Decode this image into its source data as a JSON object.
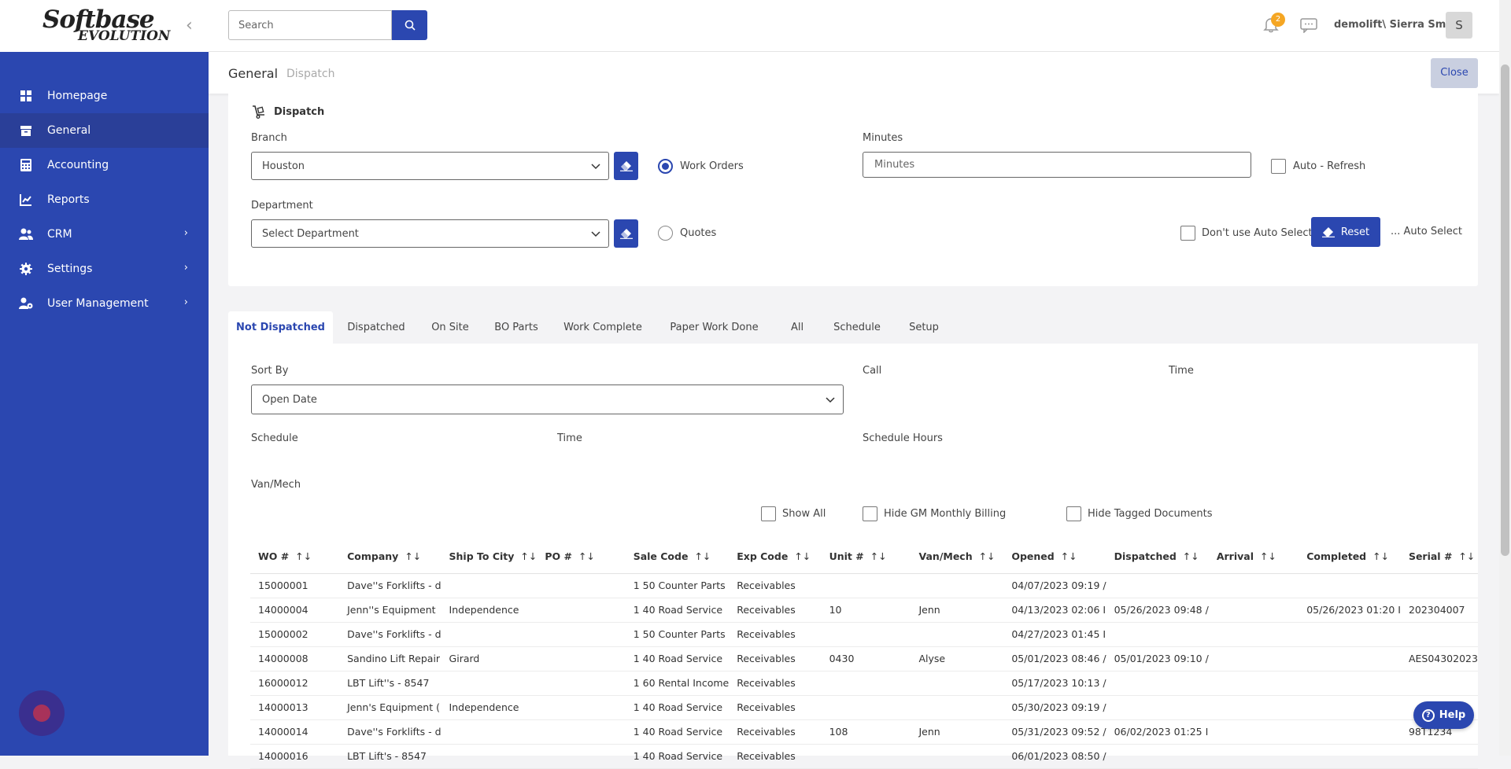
{
  "logo": {
    "line1": "Softbase",
    "line2": "EVOLUTION"
  },
  "sidebar": {
    "items": [
      {
        "label": "Homepage",
        "icon": "home-icon"
      },
      {
        "label": "General",
        "icon": "archive-icon",
        "active": true
      },
      {
        "label": "Accounting",
        "icon": "calculator-icon"
      },
      {
        "label": "Reports",
        "icon": "chart-icon"
      },
      {
        "label": "CRM",
        "icon": "users-icon",
        "expandable": true
      },
      {
        "label": "Settings",
        "icon": "gear-icon",
        "expandable": true
      },
      {
        "label": "User Management",
        "icon": "user-gear-icon",
        "expandable": true
      }
    ]
  },
  "header": {
    "search_placeholder": "Search",
    "notification_count": "2",
    "user_name": "demolift\\ Sierra Smith",
    "avatar_initial": "S"
  },
  "breadcrumb": {
    "current": "General",
    "sub": "Dispatch"
  },
  "close_label": "Close",
  "dispatch": {
    "title": "Dispatch",
    "branch_label": "Branch",
    "branch_value": "Houston",
    "department_label": "Department",
    "department_placeholder": "Select Department",
    "work_orders_label": "Work Orders",
    "quotes_label": "Quotes",
    "minutes_label": "Minutes",
    "minutes_placeholder": "Minutes",
    "auto_refresh_label": "Auto - Refresh",
    "dont_auto_select_label": "Don't use Auto Select",
    "reset_label": "Reset",
    "auto_select_text": "... Auto Select"
  },
  "tabs": [
    "Not Dispatched",
    "Dispatched",
    "On Site",
    "BO Parts",
    "Work Complete",
    "Paper Work Done",
    "All",
    "Schedule",
    "Setup"
  ],
  "filters": {
    "sort_by_label": "Sort By",
    "sort_by_value": "Open Date",
    "call_label": "Call",
    "time_label": "Time",
    "schedule_label": "Schedule",
    "schedule_time_label": "Time",
    "schedule_hours_label": "Schedule Hours",
    "van_mech_label": "Van/Mech",
    "show_all_label": "Show All",
    "hide_gm_label": "Hide GM Monthly Billing",
    "hide_tagged_label": "Hide Tagged Documents"
  },
  "table": {
    "columns": [
      "WO #",
      "Company",
      "Ship To City",
      "PO #",
      "Sale Code",
      "Exp Code",
      "Unit #",
      "Van/Mech",
      "Opened",
      "Dispatched",
      "Arrival",
      "Completed",
      "Serial #"
    ],
    "rows": [
      [
        "15000001",
        "Dave''s Forklifts - d",
        "",
        "",
        "1 50 Counter Parts",
        "Receivables",
        "",
        "",
        "04/07/2023 09:19 /",
        "",
        "",
        "",
        ""
      ],
      [
        "14000004",
        "Jenn''s Equipment",
        "Independence",
        "",
        "1 40 Road Service",
        "Receivables",
        "10",
        "Jenn",
        "04/13/2023 02:06 I",
        "05/26/2023 09:48 /",
        "",
        "05/26/2023 01:20 I",
        "202304007"
      ],
      [
        "15000002",
        "Dave''s Forklifts - d",
        "",
        "",
        "1 50 Counter Parts",
        "Receivables",
        "",
        "",
        "04/27/2023 01:45 I",
        "",
        "",
        "",
        ""
      ],
      [
        "14000008",
        "Sandino Lift Repair",
        "Girard",
        "",
        "1 40 Road Service",
        "Receivables",
        "0430",
        "Alyse",
        "05/01/2023 08:46 /",
        "05/01/2023 09:10 /",
        "",
        "",
        "AES04302023"
      ],
      [
        "16000012",
        "LBT Lift''s - 8547",
        "",
        "",
        "1 60 Rental Income",
        "Receivables",
        "",
        "",
        "05/17/2023 10:13 /",
        "",
        "",
        "",
        ""
      ],
      [
        "14000013",
        "Jenn's Equipment (",
        "Independence",
        "",
        "1 40 Road Service",
        "Receivables",
        "",
        "",
        "05/30/2023 09:19 /",
        "",
        "",
        "",
        ""
      ],
      [
        "14000014",
        "Dave''s Forklifts - d",
        "",
        "",
        "1 40 Road Service",
        "Receivables",
        "108",
        "Jenn",
        "05/31/2023 09:52 /",
        "06/02/2023 01:25 I",
        "",
        "",
        "98T1234"
      ],
      [
        "14000016",
        "LBT Lift's - 8547",
        "",
        "",
        "1 40 Road Service",
        "Receivables",
        "",
        "",
        "06/01/2023 08:50 /",
        "",
        "",
        "",
        ""
      ]
    ]
  },
  "help_label": "Help",
  "colors": {
    "primary": "#2b47b0",
    "sidebar_active": "#2a3f98",
    "badge": "#f5a623"
  }
}
